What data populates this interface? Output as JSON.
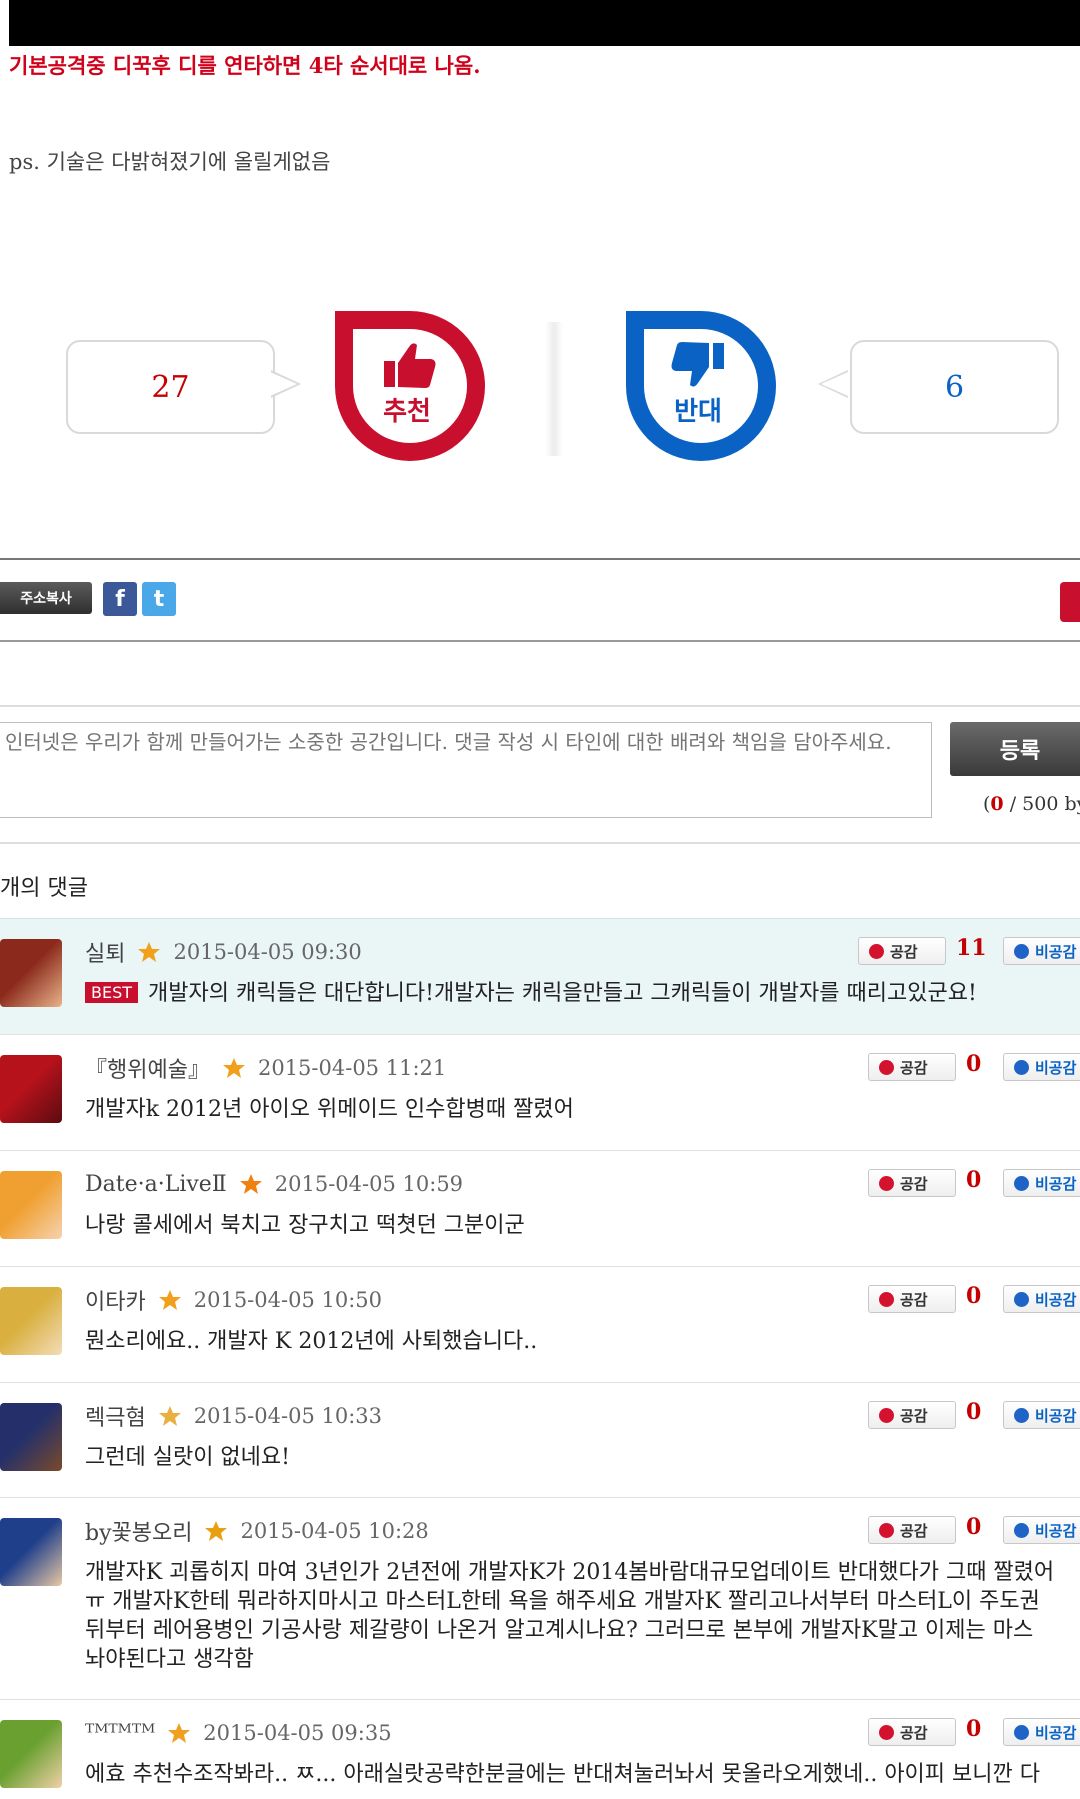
{
  "post": {
    "red_notice": "기본공격중 디꾹후 디를 연타하면 4타 순서대로 나옴.",
    "ps_line": "ps. 기술은 다밝혀졌기에 올릴게없음"
  },
  "vote": {
    "recommend_count": "27",
    "recommend_label": "추천",
    "oppose_count": "6",
    "oppose_label": "반대"
  },
  "share": {
    "copy_label": "주소복사",
    "facebook": "f",
    "twitter": "t"
  },
  "form": {
    "placeholder": "인터넷은 우리가 함께 만들어가는 소중한 공간입니다. 댓글 작성 시 타인에 대한 배려와 책임을 담아주세요.",
    "submit_label": "등록",
    "byte_open": "(",
    "byte_current": "0",
    "byte_rest": " / 500 by"
  },
  "comments_title": "개의 댓글",
  "comment_labels": {
    "agree": "공감",
    "disagree": "비공감",
    "best": "BEST"
  },
  "comments": [
    {
      "nick": "실퇴",
      "date": "2015-04-05 09:30",
      "agree": "11",
      "best": true,
      "lines": [
        "개발자의 캐릭들은 대단합니다!개발자는 캐릭을만들고 그캐릭들이 개발자를 때리고있군요!"
      ]
    },
    {
      "nick": "『행위예술』",
      "date": "2015-04-05 11:21",
      "agree": "0",
      "lines": [
        "개발자k 2012년 아이오 위메이드 인수합병때 짤렸어"
      ]
    },
    {
      "nick": "Date·a·LiveⅡ",
      "date": "2015-04-05 10:59",
      "agree": "0",
      "lines": [
        "나랑 콜세에서 북치고 장구치고 떡쳣던 그분이군"
      ]
    },
    {
      "nick": "이타카",
      "date": "2015-04-05 10:50",
      "agree": "0",
      "lines": [
        "뭔소리에요.. 개발자 K 2012년에 사퇴했습니다.."
      ]
    },
    {
      "nick": "렉극혐",
      "date": "2015-04-05 10:33",
      "agree": "0",
      "lines": [
        "그런데 실랏이 없네요!"
      ]
    },
    {
      "nick": "by꽃봉오리",
      "date": "2015-04-05 10:28",
      "agree": "0",
      "lines": [
        "개발자K 괴롭히지 마여 3년인가 2년전에 개발자K가 2014봄바람대규모업데이트 반대했다가 그때 짤렸어",
        "ㅠ 개발자K한테 뭐라하지마시고 마스터L한테 욕을 해주세요 개발자K 짤리고나서부터 마스터L이 주도권",
        "뒤부터 레어용병인 기공사랑 제갈량이 나온거 알고계시나요? 그러므로 본부에 개발자K말고 이제는 마스",
        "놔야된다고 생각함"
      ]
    },
    {
      "nick": "ᵀᴹᵀᴹᵀᴹ",
      "date": "2015-04-05 09:35",
      "agree": "0",
      "lines": [
        "에효 추천수조작봐라.. ㅉ... 아래실랏공략한분글에는 반대쳐눌러놔서 못올라오게했네.. 아이피 보니깐 다"
      ]
    }
  ],
  "colors": {
    "recommend_red": "#c8102e",
    "oppose_blue": "#0a63c4",
    "best_bg": "#eaf5f6"
  }
}
